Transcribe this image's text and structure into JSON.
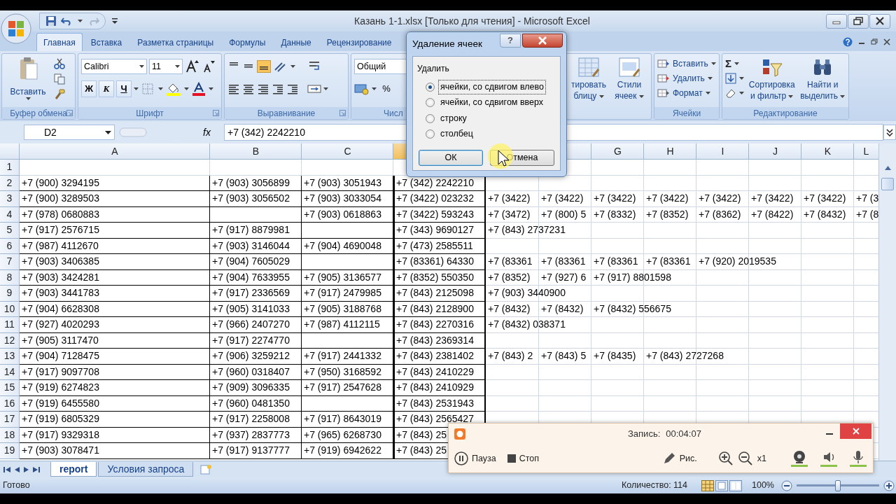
{
  "window": {
    "title": "Казань 1-1.xlsx  [Только для чтения] - Microsoft Excel"
  },
  "ribbon_tabs": [
    {
      "label": "Главная",
      "selected": true
    },
    {
      "label": "Вставка",
      "selected": false
    },
    {
      "label": "Разметка страницы",
      "selected": false
    },
    {
      "label": "Формулы",
      "selected": false
    },
    {
      "label": "Данные",
      "selected": false
    },
    {
      "label": "Рецензирование",
      "selected": false
    }
  ],
  "ribbon": {
    "clipboard": {
      "paste": "Вставить",
      "label": "Буфер обмена"
    },
    "font": {
      "name": "Calibri",
      "size": "11",
      "bold": "Ж",
      "italic": "К",
      "underline": "Ч",
      "label": "Шрифт"
    },
    "alignment": {
      "label": "Выравнивание"
    },
    "number": {
      "format": "Общий",
      "percent": "%",
      "label": "Числ"
    },
    "styles": {
      "format_table": [
        "тировать",
        "блицу"
      ],
      "cell_styles": [
        "Стили",
        "ячеек"
      ]
    },
    "cells": {
      "items": [
        "Вставить",
        "Удалить",
        "Формат"
      ],
      "label": "Ячейки"
    },
    "editing": {
      "sum": "Σ",
      "sort": [
        "Сортировка",
        "и фильтр"
      ],
      "find": [
        "Найти и",
        "выделить"
      ],
      "label": "Редактирование"
    }
  },
  "formula_bar": {
    "name_box": "D2",
    "fx": "fx",
    "value": "+7 (342) 2242210"
  },
  "columns": [
    {
      "label": "A"
    },
    {
      "label": "B"
    },
    {
      "label": "C"
    },
    {
      "selected": true
    },
    {},
    {},
    {
      "label": "G"
    },
    {
      "label": "H"
    },
    {
      "label": "I"
    },
    {
      "label": "J"
    },
    {
      "label": "K"
    },
    {
      "label": "L"
    }
  ],
  "rows": [
    {
      "number": "1",
      "cells": {}
    },
    {
      "number": "2",
      "cells": {
        "A": "+7 (900) 3294195",
        "B": "+7 (903) 3056899",
        "C": "+7 (903) 3051943",
        "D": "+7 (342) 2242210"
      }
    },
    {
      "number": "3",
      "cells": {
        "A": "+7 (900) 3289503",
        "B": "+7 (903) 3056502",
        "C": "+7 (903) 3033054",
        "D": "+7 (3422) 023232",
        "E": "+7 (3422)",
        "F": "+7 (3422)",
        "G": "+7 (3422)",
        "H": "+7 (3422)",
        "I": "+7 (3422)",
        "J": "+7 (3422)",
        "K": "+7 (3422)",
        "L": "+7 (3"
      }
    },
    {
      "number": "4",
      "cells": {
        "A": "+7 (978) 0680883",
        "C": "+7 (903) 0618863",
        "D": "+7 (3422) 593243",
        "E": "+7 (3472)",
        "F": "+7 (800) 5",
        "G": "+7 (8332)",
        "H": "+7 (8352)",
        "I": "+7 (8362)",
        "J": "+7 (8422)",
        "K": "+7 (8432)",
        "L": "+7 (8"
      }
    },
    {
      "number": "5",
      "cells": {
        "A": "+7 (917) 2576715",
        "B": "+7 (917) 8879981",
        "D": "+7 (343) 9690127",
        "E": "+7 (843) 2737231"
      }
    },
    {
      "number": "6",
      "cells": {
        "A": "+7 (987) 4112670",
        "B": "+7 (903) 3146044",
        "C": "+7 (904) 4690048",
        "D": "+7 (473) 2585511"
      }
    },
    {
      "number": "7",
      "cells": {
        "A": "+7 (903) 3406385",
        "B": "+7 (904) 7605029",
        "D": "+7 (83361) 64330",
        "E": "+7 (83361",
        "F": "+7 (83361",
        "G": "+7 (83361",
        "H": "+7 (83361",
        "I": "+7 (920) 2019535"
      }
    },
    {
      "number": "8",
      "cells": {
        "A": "+7 (903) 3424281",
        "B": "+7 (904) 7633955",
        "C": "+7 (905) 3136577",
        "D": "+7 (8352) 550350",
        "E": "+7 (8352)",
        "F": "+7 (927) 6",
        "G": "+7 (917) 8801598"
      }
    },
    {
      "number": "9",
      "cells": {
        "A": "+7 (903) 3441783",
        "B": "+7 (917) 2336569",
        "C": "+7 (917) 2479985",
        "D": "+7 (843) 2125098",
        "E": "+7 (903) 3440900"
      }
    },
    {
      "number": "10",
      "cells": {
        "A": "+7 (904) 6628308",
        "B": "+7 (905) 3141033",
        "C": "+7 (905) 3188768",
        "D": "+7 (843) 2128900",
        "E": "+7 (8432)",
        "F": "+7 (8432)",
        "G": "+7 (8432) 556675"
      }
    },
    {
      "number": "11",
      "cells": {
        "A": "+7 (927) 4020293",
        "B": "+7 (966) 2407270",
        "C": "+7 (987) 4112115",
        "D": "+7 (843) 2270316",
        "E": "+7 (8432) 038371"
      }
    },
    {
      "number": "12",
      "cells": {
        "A": "+7 (905) 3117470",
        "B": "+7 (917) 2274770",
        "D": "+7 (843) 2369314"
      }
    },
    {
      "number": "13",
      "cells": {
        "A": "+7 (904) 7128475",
        "B": "+7 (906) 3259212",
        "C": "+7 (917) 2441332",
        "D": "+7 (843) 2381402",
        "E": "+7 (843) 2",
        "F": "+7 (843) 5",
        "G": "+7 (8435)",
        "H": "+7 (843) 2727268"
      }
    },
    {
      "number": "14",
      "cells": {
        "A": "+7 (917) 9097708",
        "B": "+7 (960) 0318407",
        "C": "+7 (950) 3168592",
        "D": "+7 (843) 2410229"
      }
    },
    {
      "number": "15",
      "cells": {
        "A": "+7 (919) 6274823",
        "B": "+7 (909) 3096335",
        "C": "+7 (917) 2547628",
        "D": "+7 (843) 2410929"
      }
    },
    {
      "number": "16",
      "cells": {
        "A": "+7 (919) 6455580",
        "B": "+7 (960) 0481350",
        "D": "+7 (843) 2531943"
      }
    },
    {
      "number": "17",
      "cells": {
        "A": "+7 (919) 6805329",
        "B": "+7 (917) 2258008",
        "C": "+7 (917) 8643019",
        "D": "+7 (843) 2565427"
      }
    },
    {
      "number": "18",
      "cells": {
        "A": "+7 (917) 9329318",
        "B": "+7 (937) 2837773",
        "C": "+7 (965) 6268730",
        "D": "+7 (843) 25"
      }
    },
    {
      "number": "19",
      "cells": {
        "A": "+7 (903) 3078471",
        "B": "+7 (917) 9137777",
        "C": "+7 (919) 6942622",
        "D": "+7 (843) 25"
      }
    }
  ],
  "sheet_tabs": [
    {
      "label": "report",
      "selected": true
    },
    {
      "label": "Условия запроса",
      "selected": false
    }
  ],
  "status_bar": {
    "ready": "Готово",
    "count": "Количество: 114",
    "zoom": "100%",
    "zoom_slider": {
      "level": 0.5
    }
  },
  "dialog": {
    "title": "Удаление ячеек",
    "help": "?",
    "group": "Удалить",
    "options": [
      {
        "label": "ячейки, со сдвигом влево",
        "selected": true
      },
      {
        "label": "ячейки, со сдвигом вверх",
        "selected": false
      },
      {
        "label": "строку",
        "selected": false
      },
      {
        "label": "столбец",
        "selected": false
      }
    ],
    "buttons": [
      {
        "label": "ОК",
        "default": true
      },
      {
        "label": "Отмена",
        "default": false
      }
    ]
  },
  "recorder": {
    "label": "Запись:",
    "time": "00:04:07",
    "pause": "Пауза",
    "stop": "Стоп",
    "draw": "Рис.",
    "zoom": "x1"
  }
}
